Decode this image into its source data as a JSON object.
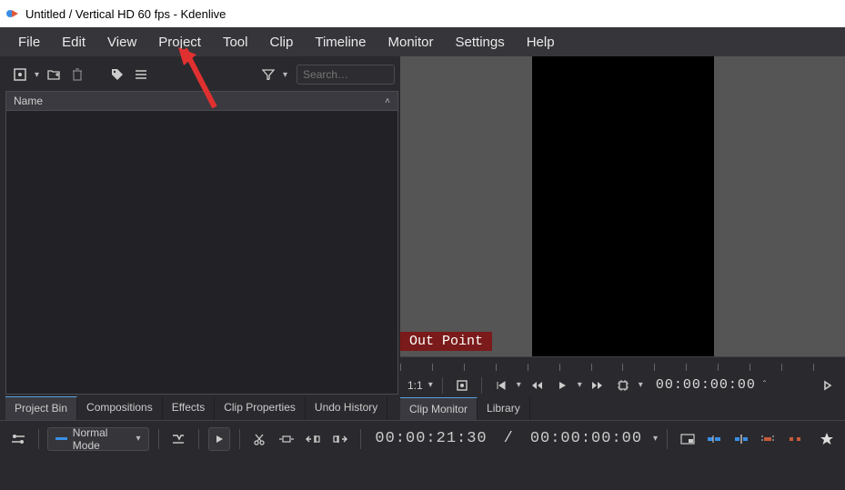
{
  "window": {
    "title": "Untitled / Vertical HD 60 fps - Kdenlive"
  },
  "menu": [
    "File",
    "Edit",
    "View",
    "Project",
    "Tool",
    "Clip",
    "Timeline",
    "Monitor",
    "Settings",
    "Help"
  ],
  "bin": {
    "search_placeholder": "Search…",
    "header": "Name"
  },
  "tabs_left": [
    "Project Bin",
    "Compositions",
    "Effects",
    "Clip Properties",
    "Undo History"
  ],
  "tabs_left_active": 0,
  "monitor": {
    "out_point_label": "Out Point",
    "scale_label": "1:1",
    "timecode": "00:00:00:00"
  },
  "tabs_right": [
    "Clip Monitor",
    "Library"
  ],
  "tabs_right_active": 0,
  "bottom": {
    "mode_label": "Normal Mode",
    "position_tc": "00:00:21:30",
    "sep": "/",
    "duration_tc": "00:00:00:00"
  }
}
